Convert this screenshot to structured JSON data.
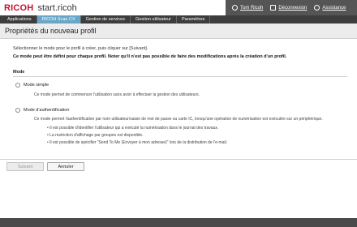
{
  "brand": {
    "company": "RICOH",
    "app": "start.ricoh"
  },
  "user_bar": {
    "user": "Tom Ricoh",
    "logout": "Déconnexion",
    "help": "Assistance"
  },
  "tabs": [
    {
      "label": "Applications",
      "active": false
    },
    {
      "label": "RICOH Scan CX",
      "active": true
    },
    {
      "label": "Gestion de services",
      "active": false
    },
    {
      "label": "Gestion utilisateur",
      "active": false
    },
    {
      "label": "Paramètres",
      "active": false
    }
  ],
  "page": {
    "title": "Propriétés du nouveau profil"
  },
  "content": {
    "intro": "Sélectionner le mode pour le profil à créer, puis cliquer sur [Suivant].",
    "warning": "Ce mode peut être défini pour chaque profil. Noter qu'il n'est pas possible de faire des modifications après la création d'un profil.",
    "section": "Mode",
    "options": [
      {
        "label": "Mode simple",
        "selected": false,
        "description": "Ce mode permet de commencer l'utilisation sans avoir à effectuer la gestion des utilisateurs."
      },
      {
        "label": "Mode d'authentification",
        "selected": false,
        "description": "Ce mode permet l'authentification par nom utilisateur/saisie de mot de passe ou carte IC, lorsqu'une opération de numérisation est exécutée sur un périphérique.",
        "bullets": [
          "• Il est possible d'identifier l'utilisateur qui a exécuté la numérisation dans le journal des travaux.",
          "• La restriction d'affichage par groupes est disponible.",
          "• Il est possible de spécifier \"Send To Me (Envoyer à mon adresse)\" lors de la distribution de l'e-mail."
        ]
      }
    ]
  },
  "buttons": {
    "next": "Suivant",
    "cancel": "Annuler"
  }
}
